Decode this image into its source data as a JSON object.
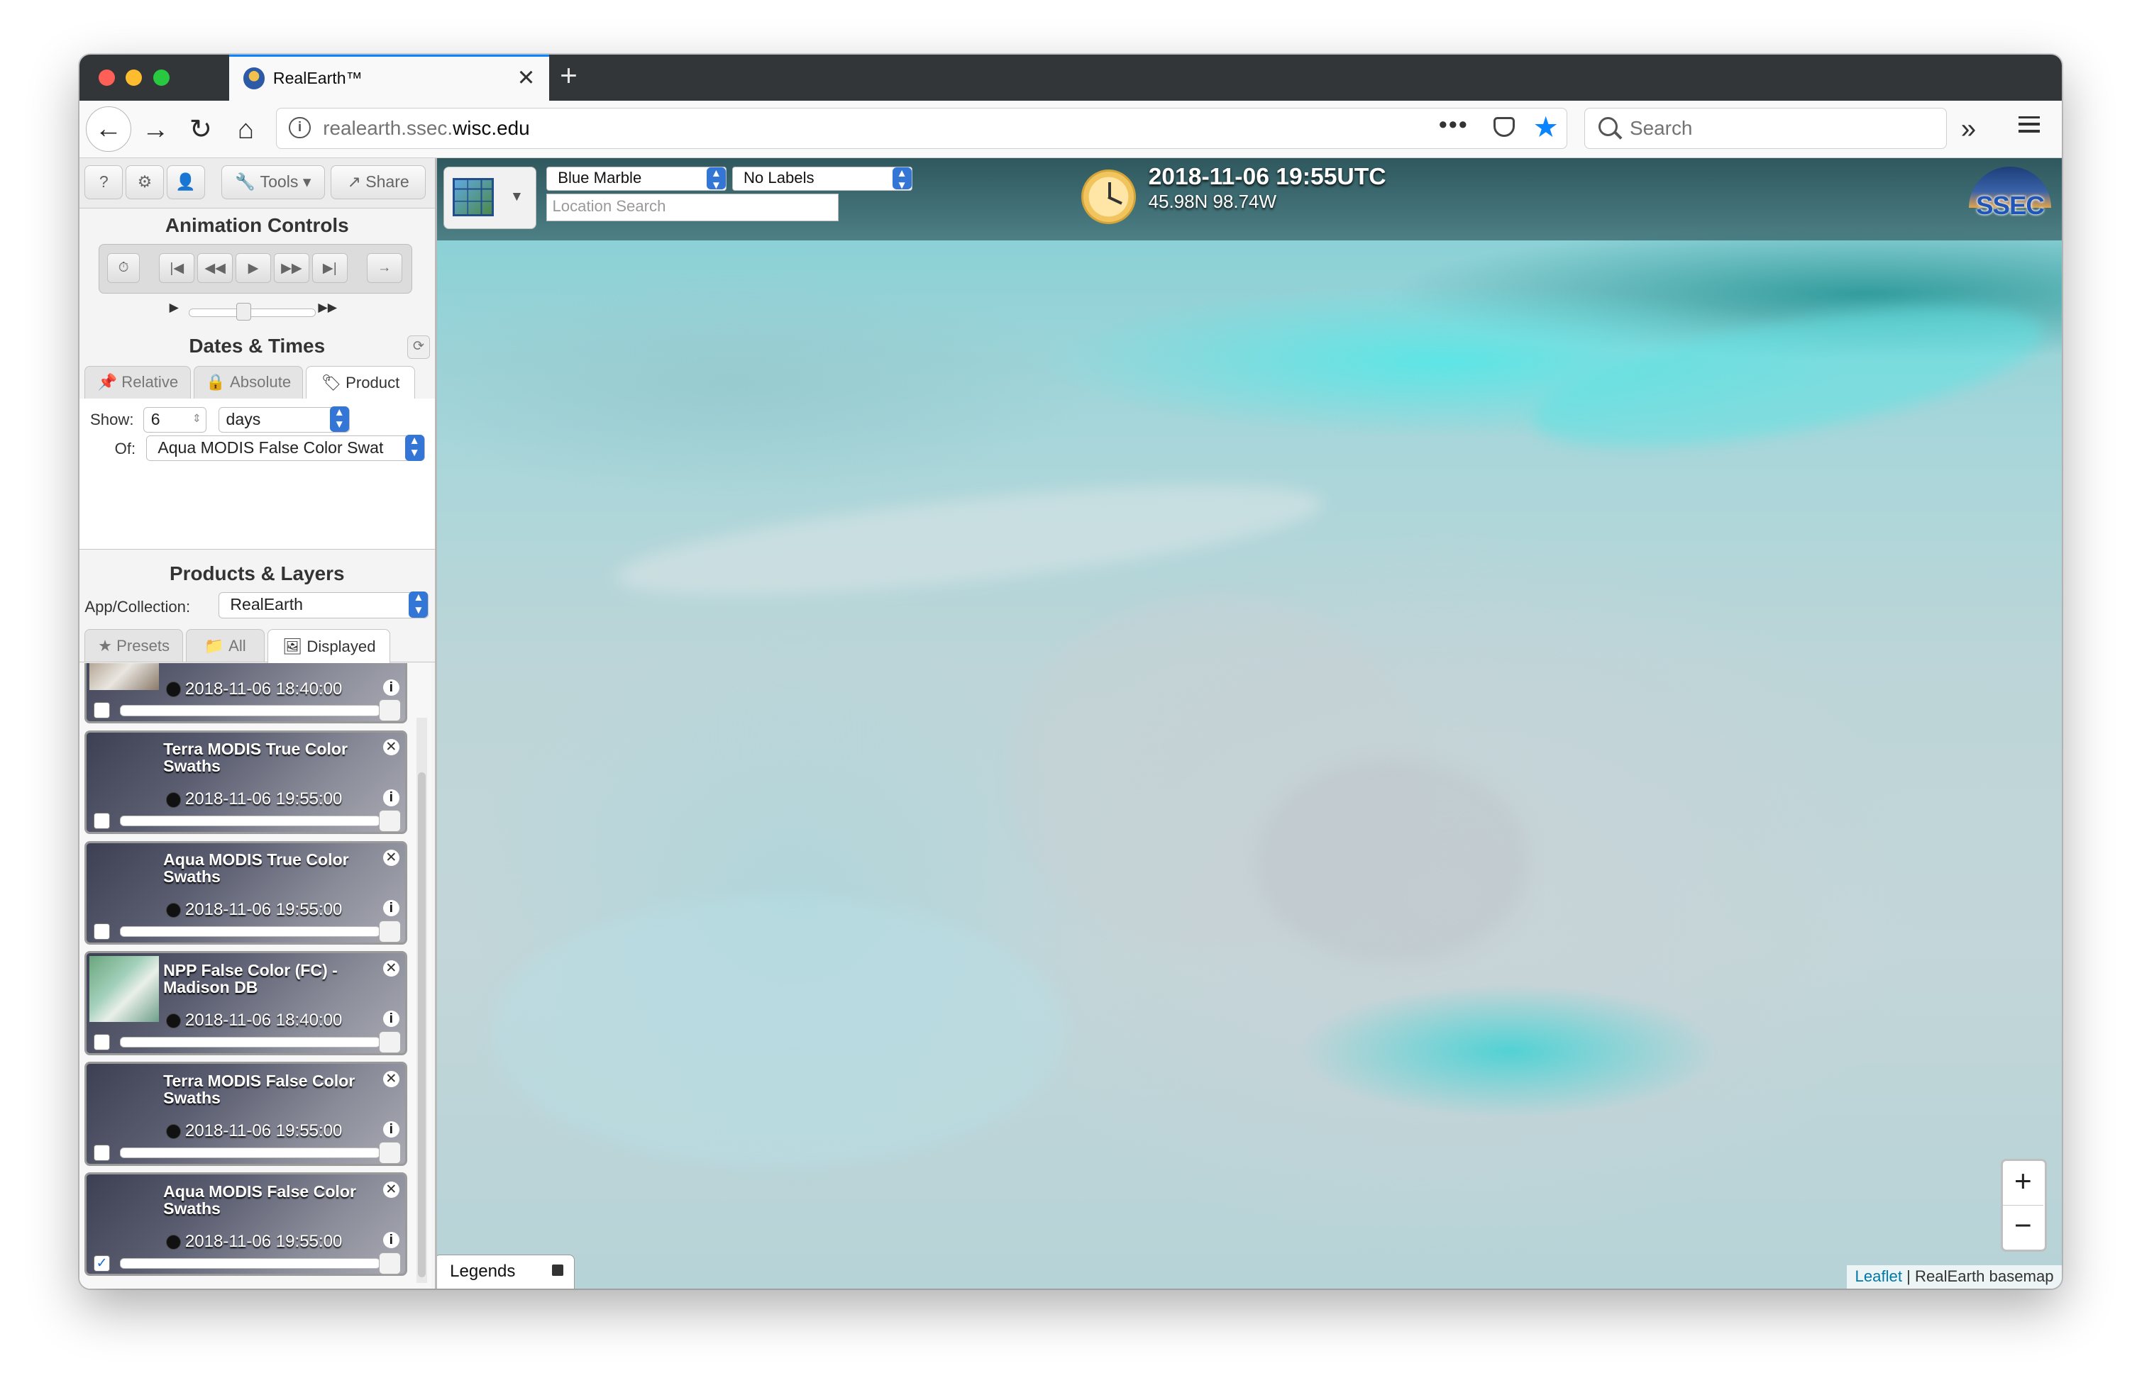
{
  "browser": {
    "tab_title": "RealEarth™",
    "new_tab": "+",
    "url_prefix": "realearth.ssec.",
    "url_domain": "wisc.edu",
    "search_placeholder": "Search"
  },
  "sidebar": {
    "toolbar": {
      "help": "?",
      "settings": "⚙",
      "user": "👤",
      "tools": "Tools",
      "share": "Share"
    },
    "animation": {
      "title": "Animation Controls",
      "buttons": [
        "⏱",
        "|◀",
        "◀◀",
        "▶",
        "▶▶",
        "▶|",
        "→"
      ],
      "speed_min": "▶",
      "speed_max": "▶▶"
    },
    "dates": {
      "title": "Dates & Times",
      "tabs": [
        "Relative",
        "Absolute",
        "Product"
      ],
      "active_tab": "Product",
      "show_label": "Show:",
      "show_value": "6",
      "unit_value": "days",
      "of_label": "Of:",
      "of_value": "Aqua MODIS False Color Swat"
    },
    "products": {
      "title": "Products & Layers",
      "collection_label": "App/Collection:",
      "collection_value": "RealEarth",
      "tabs": [
        "Presets",
        "All",
        "Displayed"
      ],
      "active_tab": "Displayed"
    },
    "layers": [
      {
        "name": "",
        "time": "2018-11-06 18:40:00",
        "checked": false,
        "thumb": true
      },
      {
        "name": "Terra MODIS True Color Swaths",
        "time": "2018-11-06 19:55:00",
        "checked": false,
        "thumb": false
      },
      {
        "name": "Aqua MODIS True Color Swaths",
        "time": "2018-11-06 19:55:00",
        "checked": false,
        "thumb": false
      },
      {
        "name": "NPP False Color (FC) - Madison DB",
        "time": "2018-11-06 18:40:00",
        "checked": false,
        "thumb": true
      },
      {
        "name": "Terra MODIS False Color Swaths",
        "time": "2018-11-06 19:55:00",
        "checked": false,
        "thumb": false
      },
      {
        "name": "Aqua MODIS False Color Swaths",
        "time": "2018-11-06 19:55:00",
        "checked": true,
        "thumb": false
      }
    ]
  },
  "map": {
    "basemap_value": "Blue Marble",
    "labels_value": "No Labels",
    "location_placeholder": "Location Search",
    "datetime": "2018-11-06 19:55UTC",
    "coords": "45.98N 98.74W",
    "logo_text": "SSEC",
    "zoom_in": "+",
    "zoom_out": "−",
    "attribution_link": "Leaflet",
    "attribution_sep": " | ",
    "attribution_text": "RealEarth basemap",
    "legends_label": "Legends"
  }
}
